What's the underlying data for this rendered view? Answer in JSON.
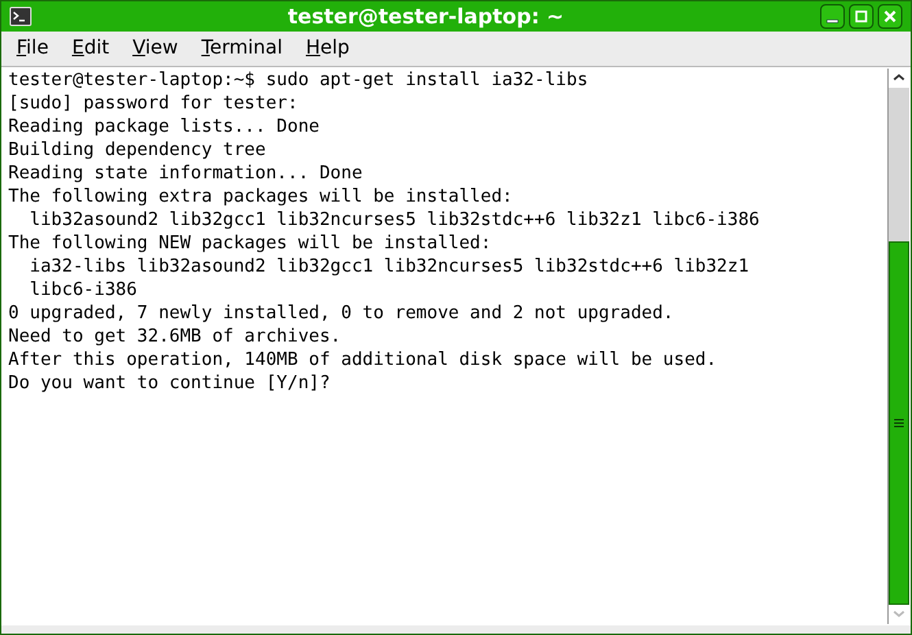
{
  "window": {
    "title": "tester@tester-laptop: ~"
  },
  "menu": [
    "File",
    "Edit",
    "View",
    "Terminal",
    "Help"
  ],
  "terminal": {
    "lines": [
      "tester@tester-laptop:~$ sudo apt-get install ia32-libs",
      "[sudo] password for tester:",
      "Reading package lists... Done",
      "Building dependency tree",
      "Reading state information... Done",
      "The following extra packages will be installed:",
      "  lib32asound2 lib32gcc1 lib32ncurses5 lib32stdc++6 lib32z1 libc6-i386",
      "The following NEW packages will be installed:",
      "  ia32-libs lib32asound2 lib32gcc1 lib32ncurses5 lib32stdc++6 lib32z1",
      "  libc6-i386",
      "0 upgraded, 7 newly installed, 0 to remove and 2 not upgraded.",
      "Need to get 32.6MB of archives.",
      "After this operation, 140MB of additional disk space will be used.",
      "Do you want to continue [Y/n]?"
    ]
  }
}
